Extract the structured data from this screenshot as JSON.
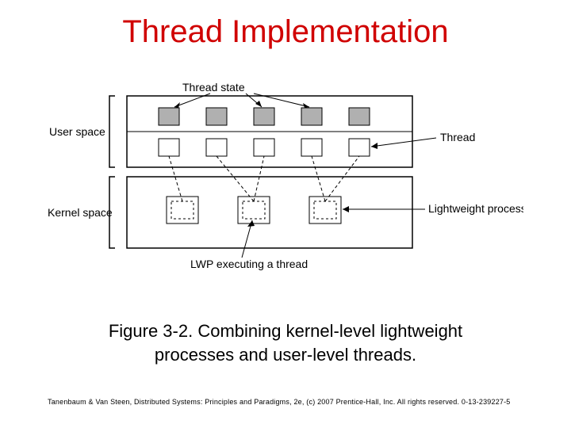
{
  "title": "Thread Implementation",
  "diagram": {
    "user_space_label": "User space",
    "kernel_space_label": "Kernel space",
    "thread_state_label": "Thread state",
    "thread_label": "Thread",
    "lightweight_process_label": "Lightweight process",
    "lwp_executing_label": "LWP executing a thread",
    "user_threads_count": 5,
    "kernel_lwp_count": 3
  },
  "caption_line1": "Figure 3-2. Combining kernel-level lightweight",
  "caption_line2": "processes and user-level threads.",
  "footer": "Tanenbaum & Van Steen, Distributed Systems: Principles and Paradigms, 2e, (c) 2007 Prentice-Hall, Inc. All rights reserved. 0-13-239227-5"
}
